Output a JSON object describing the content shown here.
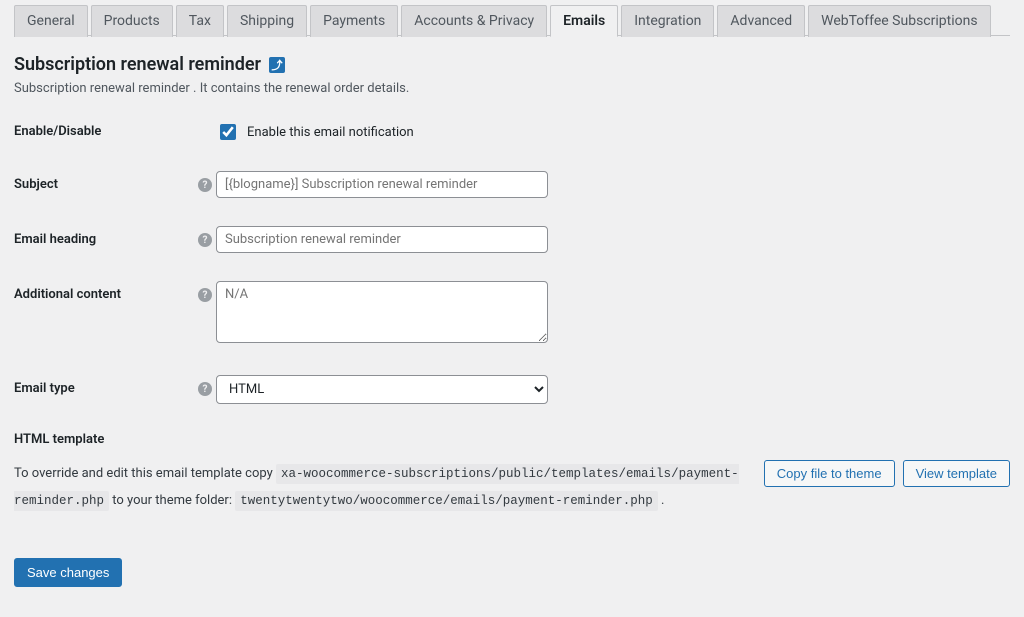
{
  "tabs": {
    "general": "General",
    "products": "Products",
    "tax": "Tax",
    "shipping": "Shipping",
    "payments": "Payments",
    "accounts": "Accounts & Privacy",
    "emails": "Emails",
    "integration": "Integration",
    "advanced": "Advanced",
    "webtoffee": "WebToffee Subscriptions"
  },
  "active_tab": "emails",
  "page": {
    "title": "Subscription renewal reminder",
    "back_glyph": "⤴",
    "description": "Subscription renewal reminder . It contains the renewal order details."
  },
  "fields": {
    "enable": {
      "label": "Enable/Disable",
      "checkbox_label": "Enable this email notification",
      "checked": true
    },
    "subject": {
      "label": "Subject",
      "placeholder": "[{blogname}] Subscription renewal reminder",
      "value": ""
    },
    "heading": {
      "label": "Email heading",
      "placeholder": "Subscription renewal reminder",
      "value": ""
    },
    "additional": {
      "label": "Additional content",
      "placeholder": "N/A",
      "value": ""
    },
    "email_type": {
      "label": "Email type",
      "value": "HTML"
    }
  },
  "template": {
    "heading": "HTML template",
    "prefix": "To override and edit this email template copy",
    "source_path": "xa-woocommerce-subscriptions/public/templates/emails/payment-reminder.php",
    "middle": "to your theme folder:",
    "dest_path": "twentytwentytwo/woocommerce/emails/payment-reminder.php",
    "suffix": ".",
    "copy_button": "Copy file to theme",
    "view_button": "View template"
  },
  "save_button": "Save changes",
  "help_glyph": "?"
}
